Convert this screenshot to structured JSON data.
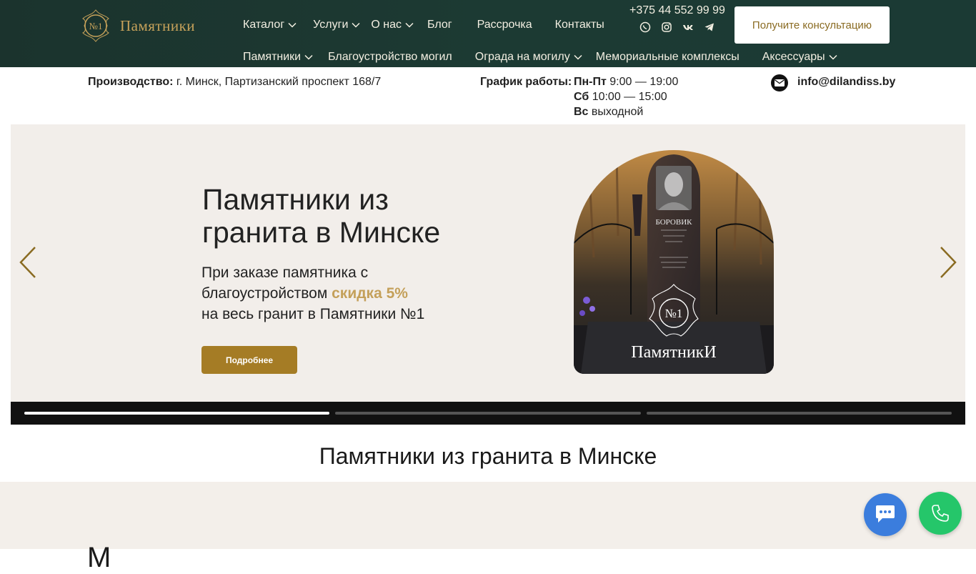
{
  "logo": {
    "text": "Памятники",
    "emblem_text": "№1"
  },
  "nav_top": [
    {
      "label": "Каталог",
      "dropdown": true
    },
    {
      "label": "Услуги",
      "dropdown": true
    },
    {
      "label": "О нас",
      "dropdown": true
    },
    {
      "label": "Блог",
      "dropdown": false
    },
    {
      "label": "Рассрочка",
      "dropdown": false
    },
    {
      "label": "Контакты",
      "dropdown": false
    }
  ],
  "nav_bottom": [
    {
      "label": "Памятники",
      "dropdown": true
    },
    {
      "label": "Благоустройство могил",
      "dropdown": false
    },
    {
      "label": "Ограда на могилу",
      "dropdown": true
    },
    {
      "label": "Мемориальные комплексы",
      "dropdown": false
    },
    {
      "label": "Аксессуары",
      "dropdown": true
    }
  ],
  "contact": {
    "phone": "+375 44 552 99 99",
    "socials": [
      "viber-icon",
      "instagram-icon",
      "vk-icon",
      "telegram-icon"
    ],
    "consult_label": "Получите консультацию"
  },
  "info": {
    "address_label": "Производство:",
    "address": "г. Минск, Партизанский проспект 168/7",
    "schedule_label": "График работы:",
    "schedule": [
      {
        "day": "Пн-Пт",
        "time": "9:00 — 19:00"
      },
      {
        "day": "Сб",
        "time": "10:00 — 15:00"
      },
      {
        "day": "Вс",
        "time": "выходной"
      }
    ],
    "email": "info@dilandiss.by"
  },
  "slider": {
    "title_line1": "Памятники из",
    "title_line2": "гранита в Минске",
    "sub_line1": "При заказе памятника с",
    "sub_line2_pre": "благоустройством ",
    "sub_line2_accent": "скидка 5%",
    "sub_line3": "на весь гранит в Памятники №1",
    "button_label": "Подробнее",
    "image": {
      "text_top": "БОРОВИК",
      "emblem_text": "№1",
      "brand": "ПамятникИ"
    },
    "current_slide": 1,
    "slide_count": 3
  },
  "heading": "Памятники из гранита в Минске",
  "colors": {
    "header_bg": "#1c3a33",
    "gold": "#c4a05a",
    "button_gold": "#a57c25",
    "chat_blue": "#3b7ddd",
    "call_green": "#25c66a"
  }
}
